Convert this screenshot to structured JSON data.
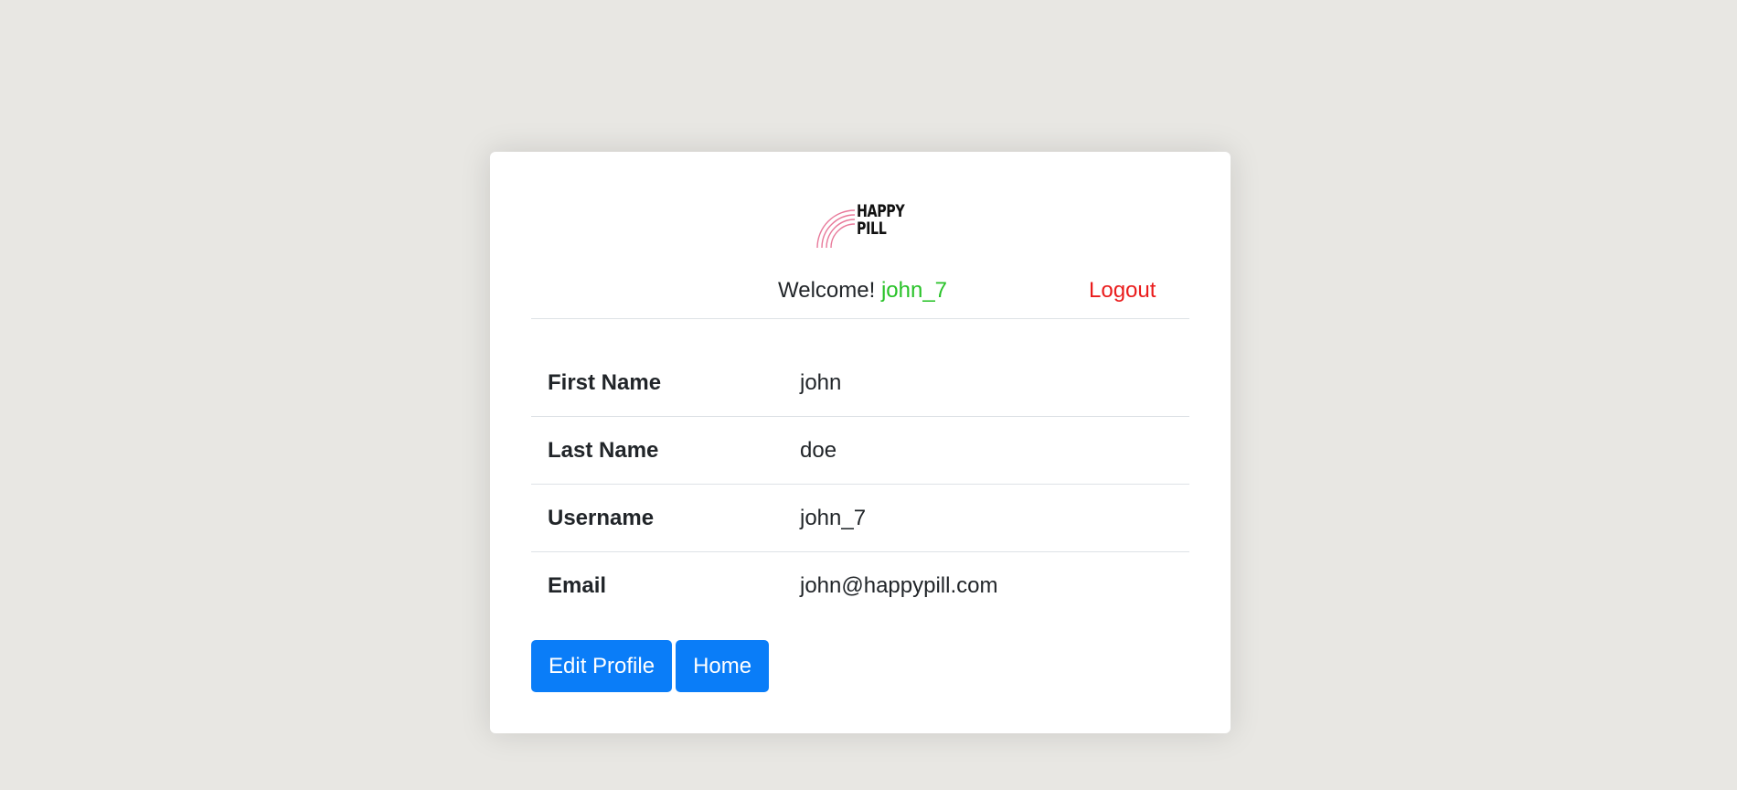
{
  "logo": {
    "text_line1": "HAPPY",
    "text_line2": "PILL",
    "arc_color": "#e8799a"
  },
  "header": {
    "welcome_text": "Welcome!",
    "username": "john_7",
    "logout_label": "Logout"
  },
  "profile": {
    "rows": [
      {
        "label": "First Name",
        "value": "john"
      },
      {
        "label": "Last Name",
        "value": "doe"
      },
      {
        "label": "Username",
        "value": "john_7"
      },
      {
        "label": "Email",
        "value": "john@happypill.com"
      }
    ]
  },
  "actions": {
    "edit_label": "Edit Profile",
    "home_label": "Home"
  },
  "colors": {
    "background": "#e8e7e3",
    "primary_button": "#0a7df8",
    "username_green": "#28c228",
    "logout_red": "#ea1c1c"
  }
}
